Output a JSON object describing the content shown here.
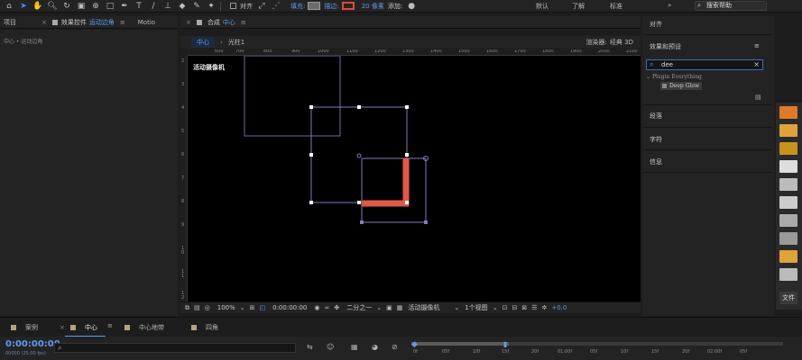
{
  "toolbar": {
    "align_label": "对齐",
    "fill_label": "填充:",
    "stroke_label": "描边:",
    "stroke_width": "20 像素",
    "add_label": "添加:",
    "workspaces": [
      "默认",
      "了解",
      "标准"
    ],
    "search_help": "搜索帮助",
    "fill_color": "#6b6b6b",
    "stroke_color": "#e04b3a"
  },
  "project_panel": {
    "tab": "项目",
    "breadcrumb": "中心 • 运动边角"
  },
  "effects_panel": {
    "tab_prefix": "效果控件",
    "tab_layer": "运动边角",
    "tab_menu": "≡",
    "motion_tab": "Motio"
  },
  "composition": {
    "tab_prefix": "合成",
    "tab_name": "中心",
    "tab_menu": "≡",
    "breadcrumbs": [
      "中心",
      "光柱1"
    ],
    "renderer_label": "渲染器:",
    "renderer": "经典 3D",
    "camera_label": "活动摄像机",
    "ruler_h": [
      "600",
      "700",
      "800",
      "900",
      "1000",
      "1100",
      "1200",
      "1300",
      "1400",
      "1500",
      "1600",
      "1700",
      "1800",
      "1900",
      "2000",
      "2100"
    ],
    "ruler_v": [
      "2",
      "3",
      "4",
      "5",
      "6",
      "7",
      "8",
      "9",
      "10",
      "11",
      "12"
    ]
  },
  "viewer_bottom": {
    "zoom": "100%",
    "timecode": "0:00:00:00",
    "resolution": "二分之一",
    "camera": "活动摄像机",
    "views": "1个视图",
    "exposure": "+0.0"
  },
  "right_panel": {
    "align": "对齐",
    "effects_presets": "效果和预设",
    "search_value": "dee",
    "plugin_group": "Plugin Everything",
    "plugin_item": "Deep Glow",
    "paragraph": "段落",
    "character": "字符",
    "info": "信息",
    "menu": "≡"
  },
  "timeline": {
    "tabs": [
      {
        "label": "案例",
        "color": "#b6a47a"
      },
      {
        "label": "中心",
        "color": "#b6a47a"
      },
      {
        "label": "中心地带",
        "color": "#b6a47a"
      },
      {
        "label": "四角",
        "color": "#b6a47a"
      }
    ],
    "close_icon": "×",
    "menu": "≡",
    "timecode": "0:00:00:00",
    "timecode_sub": "00000 (25.00 fps)",
    "ruler": [
      "0f",
      "05f",
      "10f",
      "15f",
      "20f",
      "01:00f",
      "05f",
      "10f",
      "15f",
      "20f",
      "02:00f",
      "05f"
    ]
  },
  "side_strip": {
    "label": "文件"
  }
}
